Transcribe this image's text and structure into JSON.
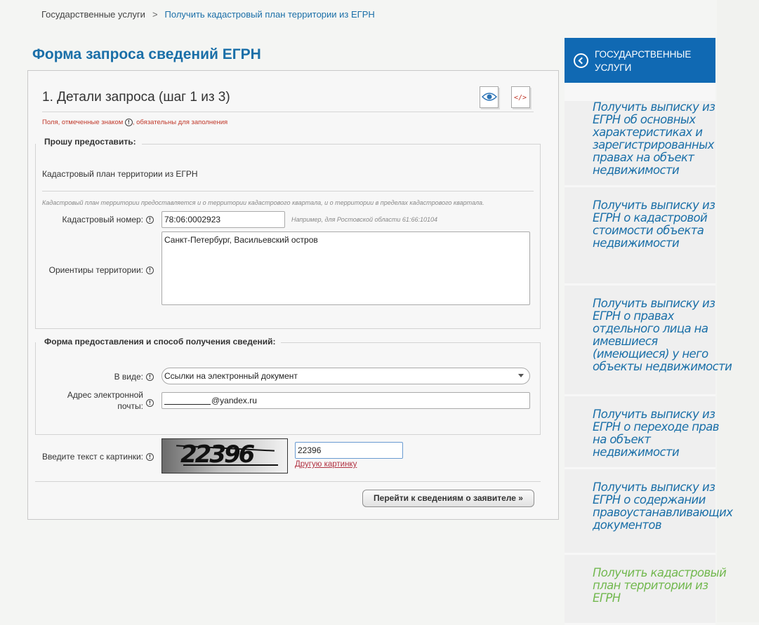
{
  "breadcrumb": {
    "home": "Государственные услуги",
    "separator": ">",
    "current": "Получить кадастровый план территории из ЕГРН"
  },
  "page_title": "Форма запроса сведений ЕГРН",
  "form": {
    "step_title": "1. Детали запроса (шаг 1 из 3)",
    "icons": [
      "preview-eye-icon",
      "xml-code-icon"
    ],
    "required_note_before": "Поля, отмеченные знаком",
    "required_note_after": ", обязательны для заполнения",
    "required_symbol": "!",
    "section1": {
      "legend": "Прошу предоставить:",
      "requested": "Кадастровый план территории из ЕГРН",
      "hint": "Кадастровый план территории предоставляется и о территории кадастрового квартала, и о территории в пределах кадастрового квартала.",
      "cadastral_label": "Кадастровый номер:",
      "cadastral_value": "78:06:0002923",
      "cadastral_example": "Например, для Ростовской области 61:66:10104",
      "landmarks_label": "Ориентиры территории:",
      "landmarks_value": "Санкт-Петербург, Васильевский остров"
    },
    "section2": {
      "legend": "Форма предоставления и способ получения сведений:",
      "format_label": "В виде:",
      "format_value": "Ссылки на электронный документ",
      "email_label_line1": "Адрес электронной",
      "email_label_line2": "почты:",
      "email_value": "@yandex.ru"
    },
    "captcha": {
      "label": "Введите текст с картинки:",
      "image_text": "22396",
      "input_value": "22396",
      "refresh_link": "Другую картинку"
    },
    "next_button": "Перейти к сведениям о заявителе »"
  },
  "sidebar": {
    "header": "Государственные услуги",
    "items": [
      {
        "label": "Получить выписку из ЕГРН об основных характеристиках и зарегистрированных правах на объект недвижимости"
      },
      {
        "label": "Получить выписку из ЕГРН о кадастровой стоимости объекта недвижимости"
      },
      {
        "label": "Получить выписку из ЕГРН о правах отдельного лица на имевшиеся (имеющиеся) у него объекты недвижимости"
      },
      {
        "label": "Получить выписку из ЕГРН о переходе прав на объект недвижимости"
      },
      {
        "label": "Получить выписку из ЕГРН о содержании правоустанавливающих документов"
      },
      {
        "label": "Получить кадастровый план территории из ЕГРН"
      }
    ]
  },
  "colors": {
    "accent_blue": "#1069b3",
    "link_blue": "#1a6fa8",
    "active_green": "#72b84f",
    "required_red": "#c0392b"
  }
}
